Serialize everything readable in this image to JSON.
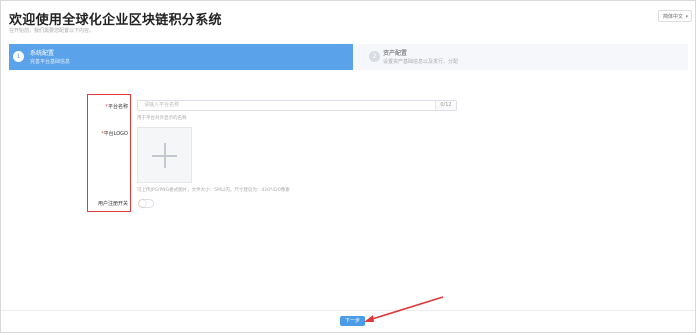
{
  "header": {
    "title": "欢迎使用全球化企业区块链积分系统",
    "subtitle": "在开始前，我们需要您配置以下内容。",
    "language": "简体中文"
  },
  "steps": [
    {
      "number": "1",
      "title": "系统配置",
      "description": "完善平台基础信息"
    },
    {
      "number": "2",
      "title": "资产配置",
      "description": "设置资产基础信息以及发行、分配"
    }
  ],
  "form": {
    "platform_name": {
      "label": "平台名称",
      "required_mark": "*",
      "placeholder": "请输入平台名称",
      "counter": "0/12",
      "help": "用于平台对外显示的名称"
    },
    "platform_logo": {
      "label": "平台LOGO",
      "required_mark": "*",
      "help": "可上传JPG/PNG格式图片，文件大小：5M以内，尺寸建议为：420*420像素"
    },
    "user_registration": {
      "label": "用户注册开关",
      "enabled": false
    }
  },
  "footer": {
    "next_label": "下一步"
  },
  "colors": {
    "primary": "#5aa2ea",
    "annotation_red": "#e03a3a"
  }
}
